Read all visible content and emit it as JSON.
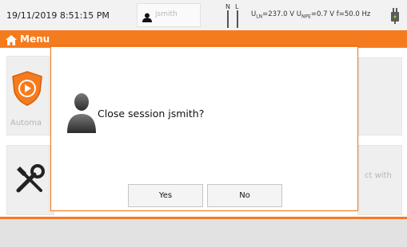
{
  "status_bar": {
    "datetime": "19/11/2019 8:51:15 PM",
    "user_name": "jsmith",
    "indicator_n": "N",
    "indicator_l": "L",
    "u_ln_label": "U",
    "u_ln_sub": "LN",
    "u_ln_value": "=237.0 V",
    "u_npe_label": " U",
    "u_npe_sub": "NPE",
    "u_npe_value": "=0.7 V",
    "frequency": " f=50.0 Hz",
    "power_icon": "plug-icon"
  },
  "menu_bar": {
    "title": "Menu",
    "home_icon": "home-icon",
    "color": "#f57b1f"
  },
  "background": {
    "auto_tile_label": "Automa",
    "settings_icon": "tools-icon",
    "right_tile_label": "ct with"
  },
  "dialog": {
    "avatar_icon": "user-silhouette-icon",
    "message": "Close session jsmith?",
    "yes_label": "Yes",
    "no_label": "No",
    "border_color": "#f57b1f"
  }
}
